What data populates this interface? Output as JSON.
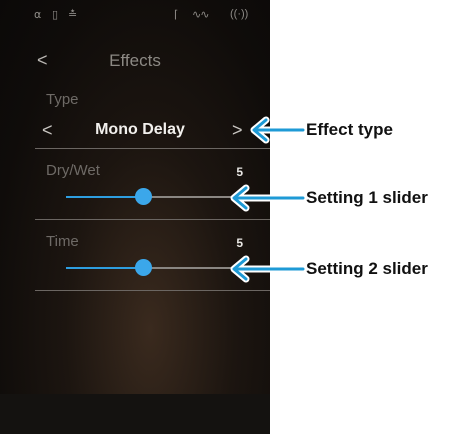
{
  "screen": {
    "title": "Effects",
    "back_label": "<",
    "type": {
      "label": "Type",
      "value": "Mono Delay",
      "prev": "<",
      "next": ">"
    },
    "settings": [
      {
        "label": "Dry/Wet",
        "value": "5",
        "fraction": 0.45
      },
      {
        "label": "Time",
        "value": "5",
        "fraction": 0.45
      }
    ],
    "accent_color": "#3ba7ea"
  },
  "status_bar": {
    "icons": [
      "headphones-icon",
      "usb-icon",
      "bluetooth-icon",
      "microphone-icon",
      "audio-wave-icon",
      "wireless-icon"
    ]
  },
  "callouts": {
    "effect_type": "Effect type",
    "setting1": "Setting 1 slider",
    "setting2": "Setting 2 slider"
  }
}
